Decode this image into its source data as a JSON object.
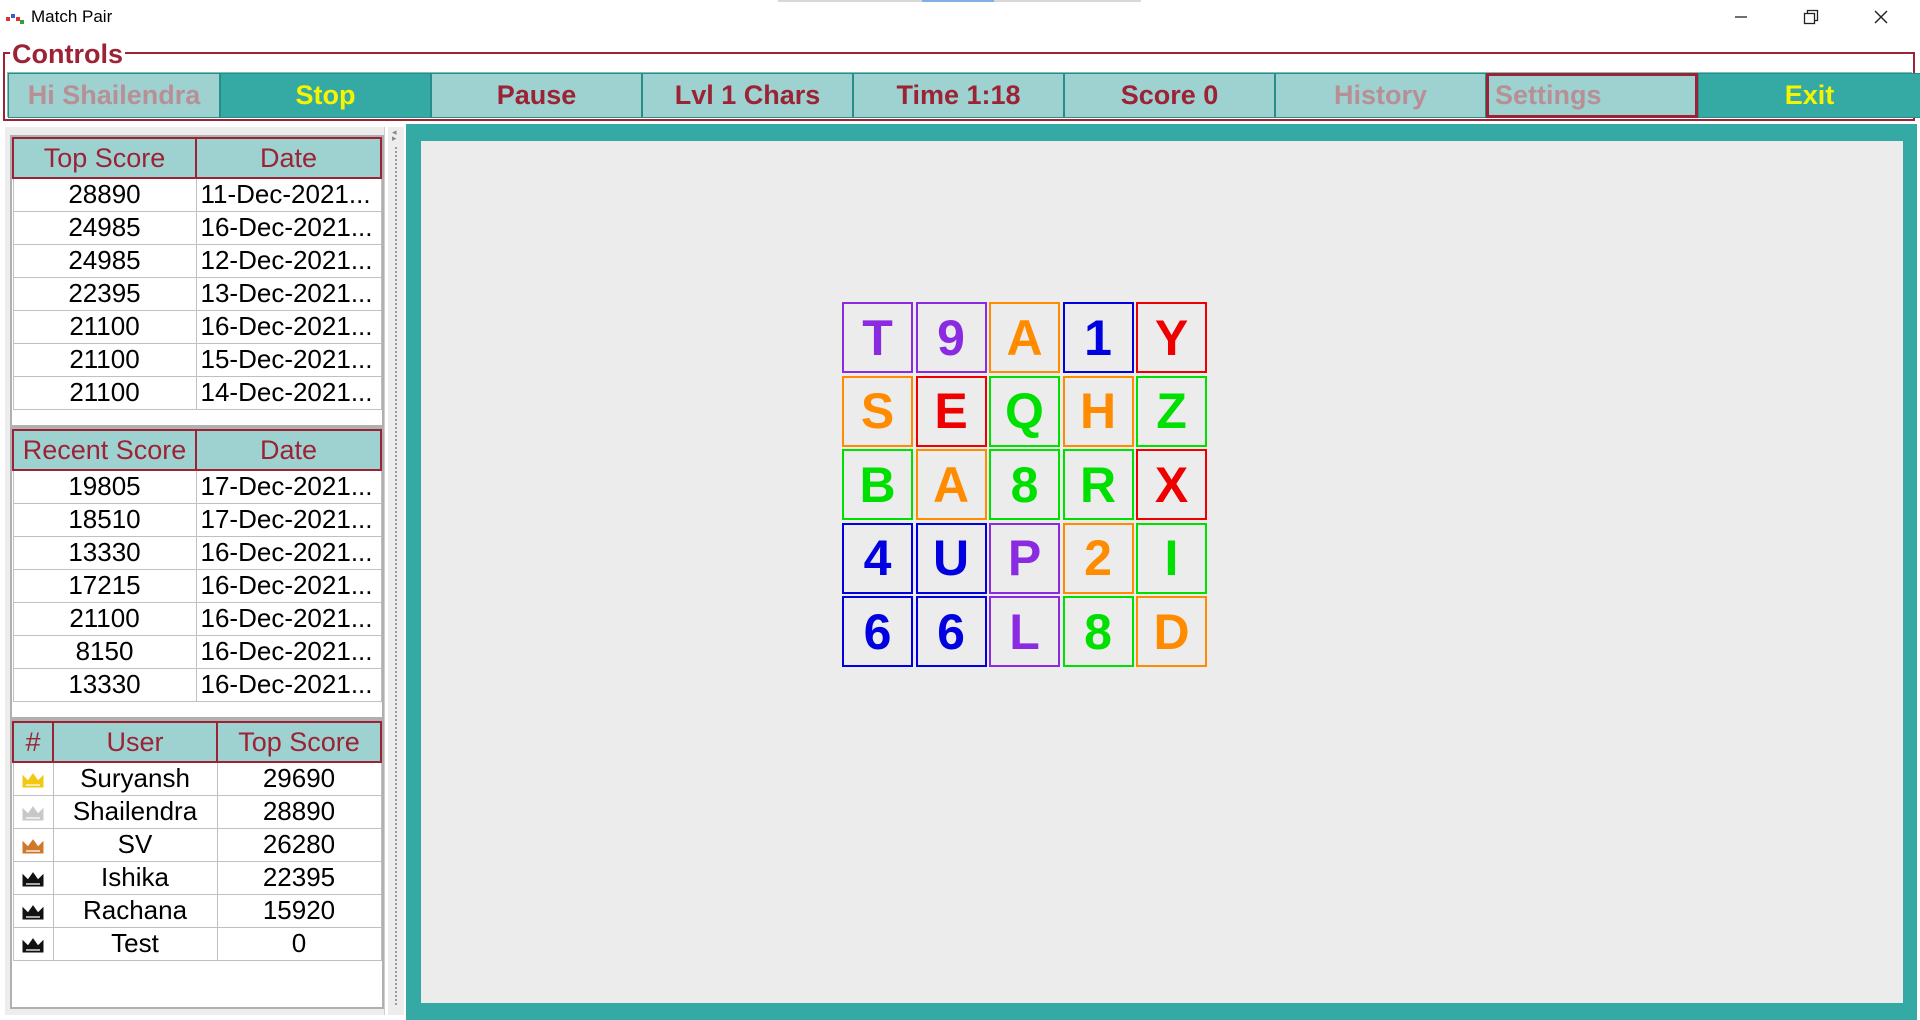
{
  "window": {
    "title": "Match Pair",
    "icon": "match-pair-app-icon",
    "controls": [
      "minimize-icon",
      "restore-icon",
      "close-icon"
    ]
  },
  "controls": {
    "group_title": "Controls",
    "buttons": [
      {
        "label": "Hi Shailendra",
        "style": "light-muted"
      },
      {
        "label": "Stop",
        "style": "dark"
      },
      {
        "label": "Pause",
        "style": "light"
      },
      {
        "label": "Lvl 1 Chars",
        "style": "light"
      },
      {
        "label": "Time 1:18",
        "style": "light"
      },
      {
        "label": "Score 0",
        "style": "light"
      },
      {
        "label": "History",
        "style": "light-muted"
      },
      {
        "label": "Settings",
        "style": "light-muted-outlined"
      },
      {
        "label": "Exit",
        "style": "dark"
      }
    ]
  },
  "top_scores": {
    "headers": [
      "Top Score",
      "Date"
    ],
    "rows": [
      [
        "28890",
        "11-Dec-2021..."
      ],
      [
        "24985",
        "16-Dec-2021..."
      ],
      [
        "24985",
        "12-Dec-2021..."
      ],
      [
        "22395",
        "13-Dec-2021..."
      ],
      [
        "21100",
        "16-Dec-2021..."
      ],
      [
        "21100",
        "15-Dec-2021..."
      ],
      [
        "21100",
        "14-Dec-2021..."
      ]
    ]
  },
  "recent_scores": {
    "headers": [
      "Recent Score",
      "Date"
    ],
    "rows": [
      [
        "19805",
        "17-Dec-2021..."
      ],
      [
        "18510",
        "17-Dec-2021..."
      ],
      [
        "13330",
        "16-Dec-2021..."
      ],
      [
        "17215",
        "16-Dec-2021..."
      ],
      [
        "21100",
        "16-Dec-2021..."
      ],
      [
        "8150",
        "16-Dec-2021..."
      ],
      [
        "13330",
        "16-Dec-2021..."
      ]
    ]
  },
  "leaderboard": {
    "headers": [
      "#",
      "User",
      "Top Score"
    ],
    "rows": [
      {
        "crown": "gold-crown-icon",
        "crown_color": "#f2c811",
        "user": "Suryansh",
        "score": "29690"
      },
      {
        "crown": "silver-crown-icon",
        "crown_color": "#c8c8c8",
        "user": "Shailendra",
        "score": "28890"
      },
      {
        "crown": "bronze-crown-icon",
        "crown_color": "#d0782a",
        "user": "SV",
        "score": "26280"
      },
      {
        "crown": "black-crown-icon",
        "crown_color": "#111111",
        "user": "Ishika",
        "score": "22395"
      },
      {
        "crown": "black-crown-icon",
        "crown_color": "#111111",
        "user": "Rachana",
        "score": "15920"
      },
      {
        "crown": "black-crown-icon",
        "crown_color": "#111111",
        "user": "Test",
        "score": "0"
      }
    ]
  },
  "board": {
    "rows": 5,
    "cols": 5,
    "tiles": [
      {
        "ch": "T",
        "color": "#8a2be2"
      },
      {
        "ch": "9",
        "color": "#8a2be2"
      },
      {
        "ch": "A",
        "color": "#ff8c00"
      },
      {
        "ch": "1",
        "color": "#0000e0"
      },
      {
        "ch": "Y",
        "color": "#ee0000"
      },
      {
        "ch": "S",
        "color": "#ff8c00"
      },
      {
        "ch": "E",
        "color": "#ee0000"
      },
      {
        "ch": "Q",
        "color": "#00e000"
      },
      {
        "ch": "H",
        "color": "#ff8c00"
      },
      {
        "ch": "Z",
        "color": "#00e000"
      },
      {
        "ch": "B",
        "color": "#00e000"
      },
      {
        "ch": "A",
        "color": "#ff8c00"
      },
      {
        "ch": "8",
        "color": "#00e000"
      },
      {
        "ch": "R",
        "color": "#00e000"
      },
      {
        "ch": "X",
        "color": "#ee0000"
      },
      {
        "ch": "4",
        "color": "#0000e0"
      },
      {
        "ch": "U",
        "color": "#0000e0"
      },
      {
        "ch": "P",
        "color": "#8a2be2"
      },
      {
        "ch": "2",
        "color": "#ff8c00"
      },
      {
        "ch": "I",
        "color": "#00e000"
      },
      {
        "ch": "6",
        "color": "#0000e0"
      },
      {
        "ch": "6",
        "color": "#0000e0"
      },
      {
        "ch": "L",
        "color": "#8a2be2"
      },
      {
        "ch": "8",
        "color": "#00e000"
      },
      {
        "ch": "D",
        "color": "#ff8c00"
      }
    ]
  },
  "colors": {
    "teal_dark": "#35a9a4",
    "teal_light": "#9dd2d0",
    "maroon": "#9b2335",
    "yellow": "#f5f500"
  }
}
